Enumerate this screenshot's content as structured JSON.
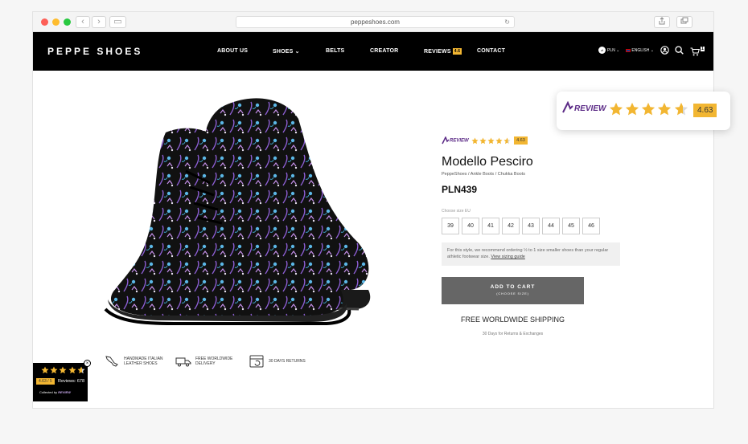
{
  "browser": {
    "url": "peppeshoes.com",
    "reload_glyph": "↻",
    "back_glyph": "‹",
    "forward_glyph": "›",
    "sidebar_glyph": "▭"
  },
  "header": {
    "logo": "PEPPE SHOES",
    "nav": [
      {
        "label": "ABOUT US"
      },
      {
        "label": "SHOES",
        "caret": "⌄"
      },
      {
        "label": "BELTS"
      },
      {
        "label": "CREATOR"
      },
      {
        "label": "REVIEWS",
        "badge": "4.6"
      },
      {
        "label": "CONTACT"
      }
    ],
    "currency": "PLN",
    "currency_symbol": "zł",
    "language": "ENGLISH",
    "cart_count": "1"
  },
  "features": [
    {
      "icon": "italy-map-icon",
      "line1": "HANDMADE ITALIAN",
      "line2": "LEATHER SHOES"
    },
    {
      "icon": "delivery-truck-icon",
      "line1": "FREE WORLDWIDE",
      "line2": "DELIVERY"
    },
    {
      "icon": "returns-box-icon",
      "line1": "30 DAYS RETURNS",
      "line2": ""
    }
  ],
  "product": {
    "rating_logo": "REVIEW",
    "rating": "4.63",
    "rating_stars": 4.63,
    "title": "Modello Pesciro",
    "breadcrumbs": [
      "PeppeShoes",
      "Ankle Boots",
      "Chukka Boots"
    ],
    "breadcrumb_sep": "/",
    "price": "PLN439",
    "size_label": "Choose size EU",
    "sizes": [
      "39",
      "40",
      "41",
      "42",
      "43",
      "44",
      "45",
      "46"
    ],
    "note_text": "For this style, we recommend ordering ½ to 1 size smaller shoes than your regular athletic footwear size.",
    "note_link": "View sizing guide",
    "cart_label": "ADD TO CART",
    "cart_sub": "(CHOOSE SIZE)",
    "shipping": "FREE WORLDWIDE SHIPPING",
    "shipping_sub": "30 Days for Returns & Exchanges"
  },
  "popup": {
    "logo": "REVIEW",
    "rating": "4.63",
    "rating_stars": 4.63
  },
  "widget": {
    "score": "4.63 / 5",
    "reviews": "Reviews: 678",
    "collected_by": "Collected by",
    "collected_logo": "REVIEW"
  },
  "colors": {
    "accent": "#f2b632",
    "brand_purple": "#5b2a86",
    "header_bg": "#000000",
    "cart_bg": "#666666"
  }
}
